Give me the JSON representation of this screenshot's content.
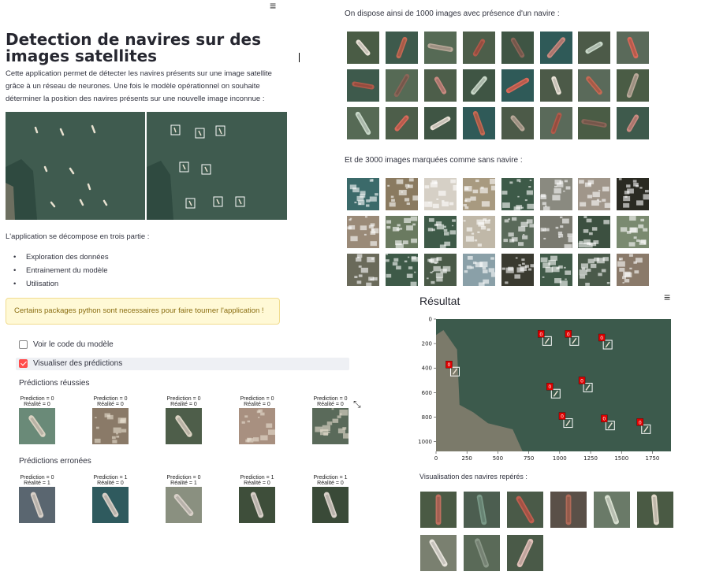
{
  "title": "Detection de navires sur des images satellites",
  "intro": "Cette application permet de détecter les navires présents sur une image satellite grâce à un réseau de neurones. Une fois le modèle opérationnel on souhaite déterminer la position des navires présents sur une nouvelle image inconnue :",
  "app_parts_heading": "L'application se décompose en trois partie :",
  "app_parts": [
    "Exploration des données",
    "Entrainement du modèle",
    "Utilisation"
  ],
  "warning": "Certains packages python sont necessaires pour faire tourner l'application !",
  "checkbox_code": {
    "label": "Voir le code du modèle",
    "checked": false
  },
  "checkbox_pred": {
    "label": "Visualiser des prédictions",
    "checked": true
  },
  "success_heading": "Prédictions réussies",
  "error_heading": "Prédictions erronées",
  "success_preds": [
    {
      "pred": "Prediction = 0",
      "real": "Réalité = 0"
    },
    {
      "pred": "Prediction = 0",
      "real": "Réalité = 0"
    },
    {
      "pred": "Prediction = 0",
      "real": "Réalité = 0"
    },
    {
      "pred": "Prediction = 0",
      "real": "Réalité = 0"
    },
    {
      "pred": "Prediction = 0",
      "real": "Réalité = 0"
    }
  ],
  "error_preds": [
    {
      "pred": "Prediction = 0",
      "real": "Réalité = 1"
    },
    {
      "pred": "Prediction = 1",
      "real": "Réalité = 0"
    },
    {
      "pred": "Prediction = 0",
      "real": "Réalité = 1"
    },
    {
      "pred": "Prediction = 1",
      "real": "Réalité = 0"
    },
    {
      "pred": "Prediction = 1",
      "real": "Réalité = 0"
    }
  ],
  "ships_heading": "On dispose ainsi de 1000 images avec présence d'un navire :",
  "noships_heading": "Et de 3000 images marquées comme sans navire :",
  "result_title": "Résultat",
  "detected_heading": "Visualisation des navires repérés :",
  "menu_icon": "≡",
  "fullscreen_icon": "⤡",
  "colors": {
    "accent": "#ff4b4b",
    "sea": "#3d5a4e",
    "marker": "#e00000"
  },
  "chart_data": {
    "type": "scatter",
    "x_ticks": [
      "0",
      "250",
      "500",
      "750",
      "1000",
      "1250",
      "1500",
      "1750"
    ],
    "y_ticks": [
      "0",
      "200",
      "400",
      "600",
      "800",
      "1000"
    ],
    "detections": [
      {
        "label": "0",
        "x": 850,
        "y": 150
      },
      {
        "label": "0",
        "x": 1070,
        "y": 150
      },
      {
        "label": "0",
        "x": 1340,
        "y": 180
      },
      {
        "label": "0",
        "x": 105,
        "y": 400
      },
      {
        "label": "0",
        "x": 920,
        "y": 580
      },
      {
        "label": "0",
        "x": 1180,
        "y": 530
      },
      {
        "label": "0",
        "x": 1020,
        "y": 820
      },
      {
        "label": "0",
        "x": 1360,
        "y": 840
      },
      {
        "label": "0",
        "x": 1650,
        "y": 870
      }
    ]
  }
}
